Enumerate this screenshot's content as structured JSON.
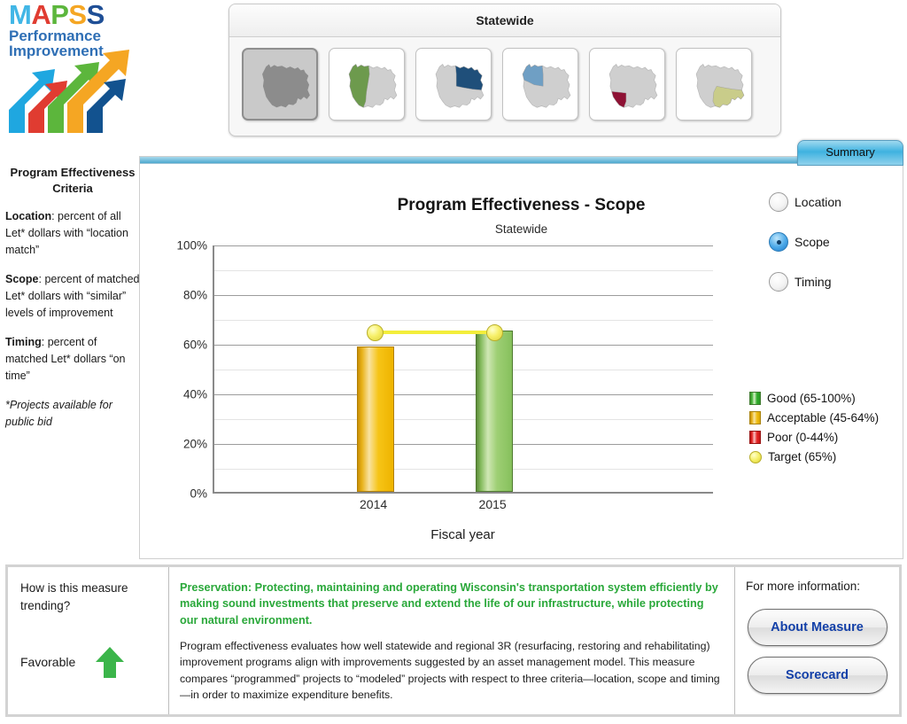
{
  "logo": {
    "letters": [
      {
        "char": "M",
        "color": "#41b6e6"
      },
      {
        "char": "A",
        "color": "#e03c31"
      },
      {
        "char": "P",
        "color": "#5cb63c"
      },
      {
        "char": "S",
        "color": "#f5a623"
      },
      {
        "char": "S",
        "color": "#1f4f96"
      }
    ],
    "line1": "Performance",
    "line2": "Improvement"
  },
  "mapbar": {
    "title": "Statewide",
    "thumbs": [
      {
        "name": "statewide",
        "selected": true,
        "highlight": "#8c8c8c"
      },
      {
        "name": "northwest-region",
        "selected": false,
        "highlight": "#6d9a4d"
      },
      {
        "name": "northeast-region",
        "selected": false,
        "highlight": "#1f4f7a"
      },
      {
        "name": "north-central-region",
        "selected": false,
        "highlight": "#6f9fc4"
      },
      {
        "name": "southwest-region",
        "selected": false,
        "highlight": "#8e1134"
      },
      {
        "name": "southeast-region",
        "selected": false,
        "highlight": "#c9cc8a"
      }
    ]
  },
  "tab": {
    "summary_label": "Summary"
  },
  "criteria": {
    "heading": "Program Effectiveness Criteria",
    "items": [
      {
        "term": "Location",
        "text": ": percent of all Let* dollars with “location match”"
      },
      {
        "term": "Scope",
        "text": ": percent of matched Let* dollars with “similar” levels of improvement"
      },
      {
        "term": "Timing",
        "text": ": percent of matched Let* dollars “on time”"
      }
    ],
    "footnote": "*Projects available for public bid"
  },
  "radios": {
    "options": [
      {
        "label": "Location",
        "selected": false
      },
      {
        "label": "Scope",
        "selected": true
      },
      {
        "label": "Timing",
        "selected": false
      }
    ]
  },
  "chart_data": {
    "type": "bar",
    "title": "Program Effectiveness - Scope",
    "subtitle": "Statewide",
    "categories": [
      "2014",
      "2015"
    ],
    "values": [
      58.5,
      65
    ],
    "bar_status": [
      "acceptable",
      "good"
    ],
    "target": 65,
    "target_series_name": "Target (65%)",
    "xlabel": "Fiscal year",
    "ylabel": "",
    "ylim": [
      0,
      100
    ],
    "ytick_labels": [
      "0%",
      "20%",
      "40%",
      "60%",
      "80%",
      "100%"
    ],
    "ytick_values": [
      0,
      20,
      40,
      60,
      80,
      100
    ],
    "minor_gridlines": [
      10,
      30,
      50,
      70,
      90
    ],
    "grid": true,
    "legend_position": "right",
    "legend": [
      {
        "label": "Good (65-100%)",
        "swatch": "good"
      },
      {
        "label": "Acceptable (45-64%)",
        "swatch": "acceptable"
      },
      {
        "label": "Poor (0-44%)",
        "swatch": "poor"
      },
      {
        "label": "Target (65%)",
        "swatch": "target"
      }
    ]
  },
  "bottom": {
    "trend_question": "How is this measure trending?",
    "trend_value": "Favorable",
    "trend_direction": "up",
    "goal_text": "Preservation: Protecting, maintaining and operating Wisconsin's transportation system efficiently by making sound investments that preserve and extend the life of our infrastructure, while protecting our natural environment.",
    "description": "Program effectiveness evaluates how well statewide and regional 3R (resurfacing, restoring and rehabilitating) improvement programs align with improvements suggested by an asset management model. This measure compares “programmed” projects to “modeled” projects with respect to three criteria—location, scope and timing—in order to maximize expenditure benefits.",
    "info_label": "For more information:",
    "about_button": "About Measure",
    "scorecard_button": "Scorecard"
  }
}
